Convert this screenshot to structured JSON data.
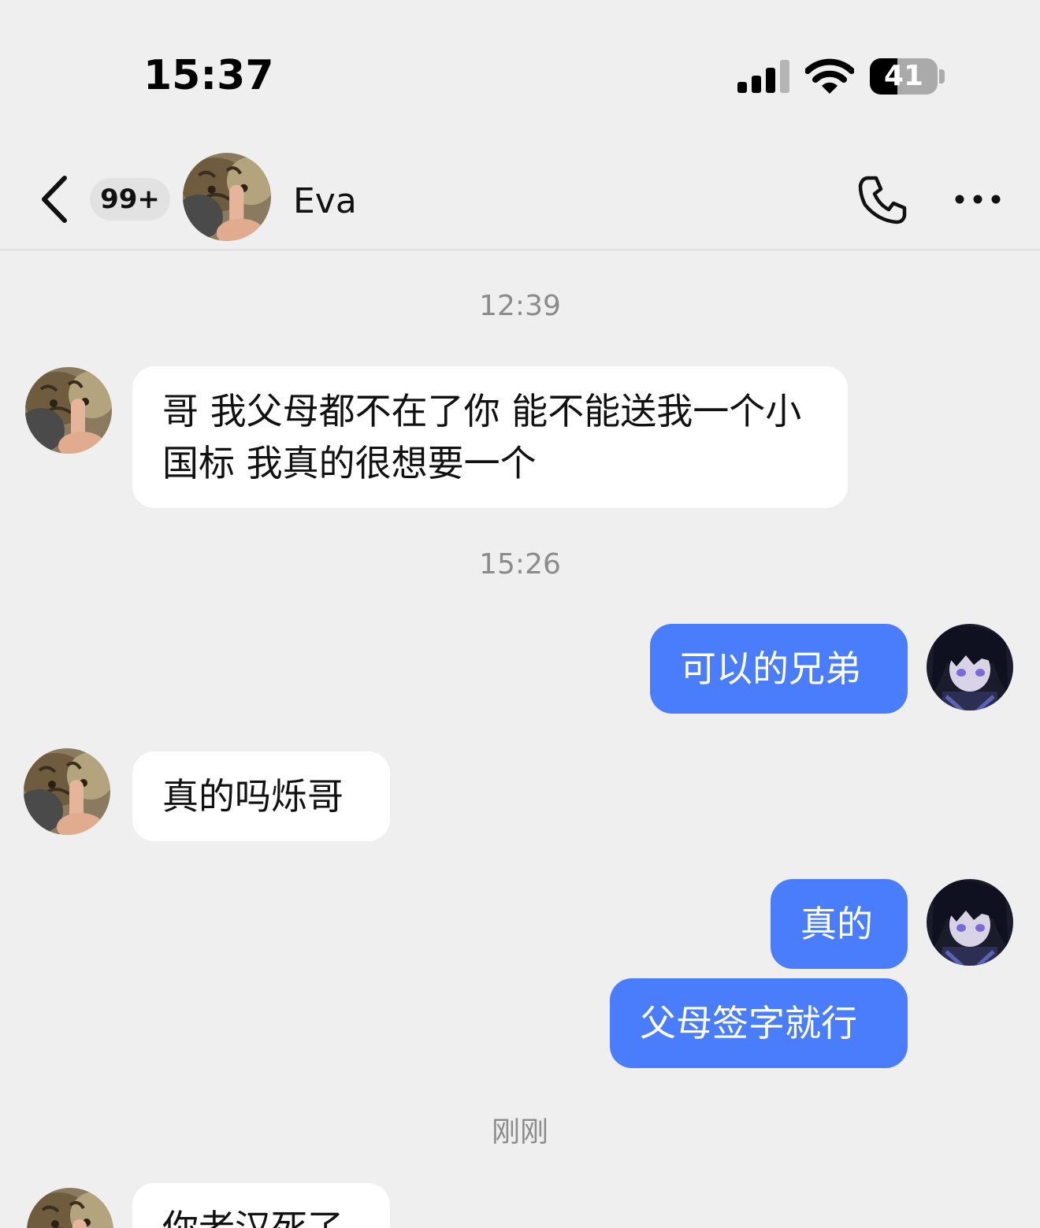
{
  "status_bar": {
    "time": "15:37",
    "battery_level": "41",
    "battery_fraction": 0.41,
    "icons": [
      "cellular-signal-icon",
      "wifi-icon",
      "battery-icon"
    ]
  },
  "header": {
    "unread_count": "99+",
    "contact_name": "Eva",
    "icons": [
      "chevron-left-icon",
      "phone-icon",
      "more-dots-icon"
    ]
  },
  "chat": {
    "time_labels": [
      "12:39",
      "15:26",
      "刚刚"
    ],
    "messages": [
      {
        "direction": "in",
        "text": "哥 我父母都不在了你 能不能送我一个小国标 我真的很想要一个"
      },
      {
        "direction": "out",
        "text": "可以的兄弟"
      },
      {
        "direction": "in",
        "text": "真的吗烁哥"
      },
      {
        "direction": "out",
        "text": "真的"
      },
      {
        "direction": "out",
        "text": "父母签字就行"
      },
      {
        "direction": "in",
        "text": "你老汉死了"
      }
    ]
  },
  "colors": {
    "background": "#efefef",
    "incoming_bubble": "#ffffff",
    "outgoing_bubble": "#4a7dfb",
    "timestamp_text": "#8b8b8b"
  }
}
